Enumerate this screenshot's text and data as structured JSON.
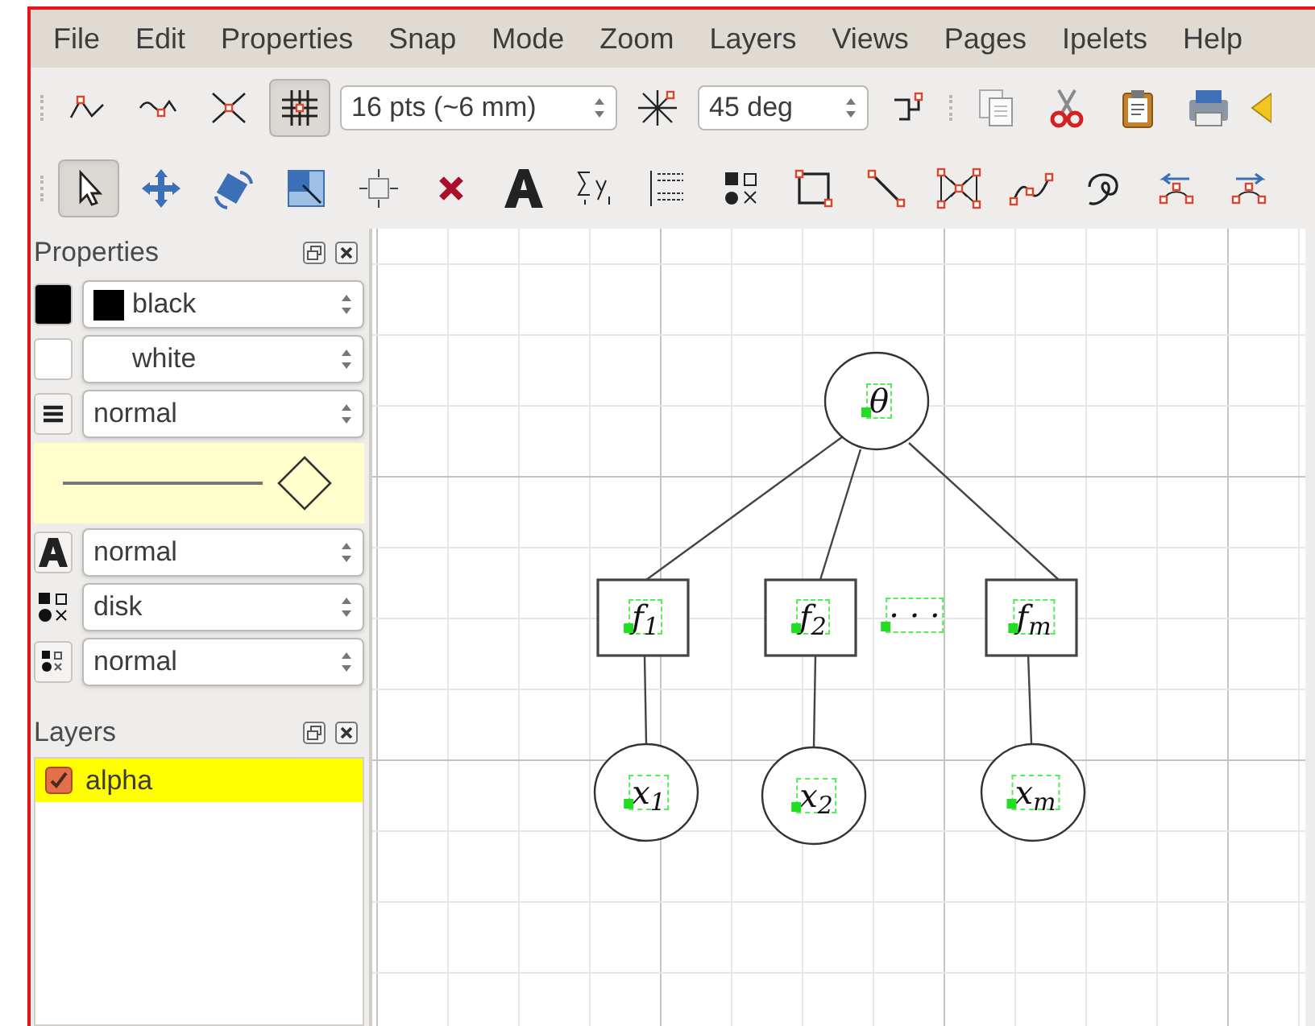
{
  "menu": [
    "File",
    "Edit",
    "Properties",
    "Snap",
    "Mode",
    "Zoom",
    "Layers",
    "Views",
    "Pages",
    "Ipelets",
    "Help"
  ],
  "snap_toolbar": {
    "buttons": [
      {
        "selected": false
      },
      {
        "selected": false
      },
      {
        "selected": false
      },
      {
        "selected": true
      }
    ],
    "grid_size": "16 pts (~6 mm)",
    "angle_snap": {
      "selected": false
    },
    "angle": "45 deg",
    "custom_snap": {
      "selected": false
    }
  },
  "mode_toolbar": {
    "tools": [
      {
        "selected": true
      },
      {
        "selected": false
      },
      {
        "selected": false
      },
      {
        "selected": false
      },
      {
        "selected": false
      },
      {
        "selected": false
      },
      {
        "selected": false
      },
      {
        "selected": false
      },
      {
        "selected": false
      },
      {
        "selected": false
      },
      {
        "selected": false
      },
      {
        "selected": false
      },
      {
        "selected": false
      },
      {
        "selected": false
      },
      {
        "selected": false
      },
      {
        "selected": false
      },
      {
        "selected": false
      }
    ]
  },
  "properties": {
    "title": "Properties",
    "stroke": {
      "color": "#000000",
      "value": "black"
    },
    "fill": {
      "color": "#ffffff",
      "value": "white"
    },
    "pen": "normal",
    "text_size": "normal",
    "mark_shape": "disk",
    "mark_size": "normal"
  },
  "layers": {
    "title": "Layers",
    "items": [
      {
        "name": "alpha",
        "checked": true,
        "selected": true
      }
    ]
  },
  "canvas": {
    "nodes": [
      {
        "kind": "ellipse",
        "label": "θ"
      },
      {
        "kind": "box",
        "label": "f$_{1}$"
      },
      {
        "kind": "box",
        "label": "f$_{2}$"
      },
      {
        "kind": "text",
        "label": "· · ·"
      },
      {
        "kind": "box",
        "label": "f$_{m}$"
      },
      {
        "kind": "ellipse",
        "label": "x$_{1}$"
      },
      {
        "kind": "ellipse",
        "label": "x$_{2}$"
      },
      {
        "kind": "ellipse",
        "label": "x$_{m}$"
      }
    ]
  }
}
